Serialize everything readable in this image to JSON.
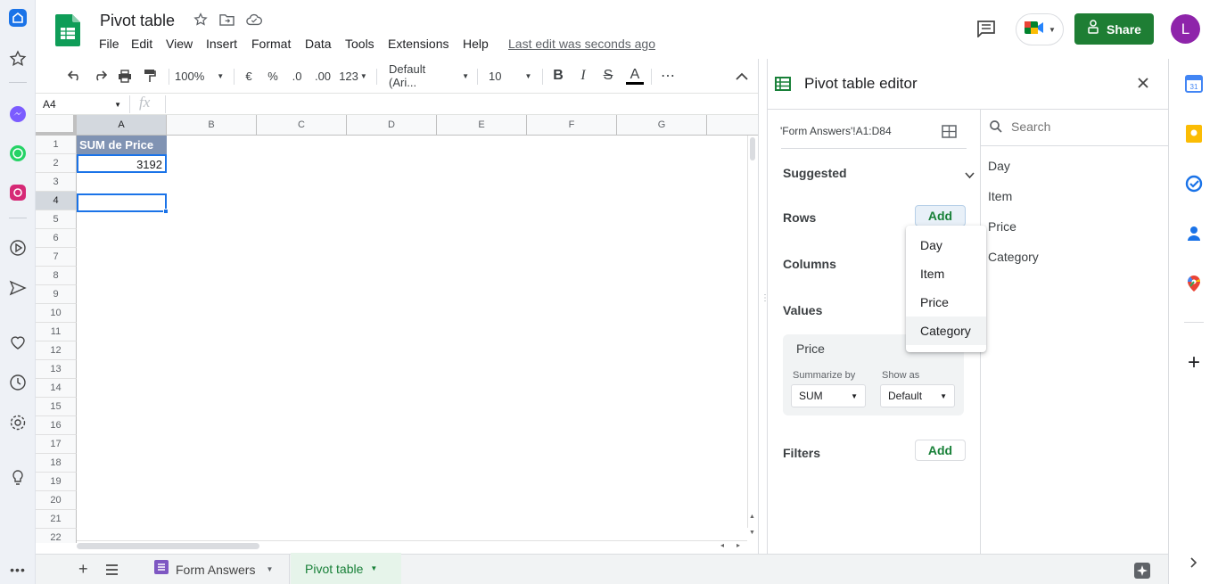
{
  "doc": {
    "title": "Pivot table",
    "last_edit": "Last edit was seconds ago",
    "share_label": "Share",
    "avatar_letter": "L"
  },
  "menu": [
    "File",
    "Edit",
    "View",
    "Insert",
    "Format",
    "Data",
    "Tools",
    "Extensions",
    "Help"
  ],
  "toolbar": {
    "zoom": "100%",
    "currency": "€",
    "percent": "%",
    "dec_decrease": ".0",
    "dec_increase": ".00",
    "format_more": "123",
    "font": "Default (Ari...",
    "font_size": "10",
    "bold": "B",
    "italic": "I",
    "strike": "S",
    "text_color": "A",
    "more": "⋯"
  },
  "formula_bar": {
    "cell_ref": "A4",
    "fx": "fx",
    "value": ""
  },
  "grid": {
    "columns": [
      "A",
      "B",
      "C",
      "D",
      "E",
      "F",
      "G"
    ],
    "rows": [
      "1",
      "2",
      "3",
      "4",
      "5",
      "6",
      "7",
      "8",
      "9",
      "10",
      "11",
      "12",
      "13",
      "14",
      "15",
      "16",
      "17",
      "18",
      "19",
      "20",
      "21",
      "22"
    ],
    "a1": "SUM de Price",
    "a2": "3192"
  },
  "sheets": [
    {
      "name": "Form Answers",
      "active": false
    },
    {
      "name": "Pivot table",
      "active": true
    }
  ],
  "editor": {
    "title": "Pivot table editor",
    "range": "'Form Answers'!A1:D84",
    "suggested": "Suggested",
    "rows_label": "Rows",
    "columns_label": "Columns",
    "values_label": "Values",
    "filters_label": "Filters",
    "add_label": "Add",
    "value_card": {
      "field": "Price",
      "summarize_label": "Summarize by",
      "summarize_value": "SUM",
      "show_as_label": "Show as",
      "show_as_value": "Default"
    },
    "search_placeholder": "Search",
    "fields": [
      "Day",
      "Item",
      "Price",
      "Category"
    ],
    "dropdown": [
      "Day",
      "Item",
      "Price",
      "Category"
    ]
  },
  "colors": {
    "accent_green": "#188038",
    "share_bg": "#1e7e34",
    "header_cell_bg": "#8093b3",
    "selection_blue": "#1a73e8",
    "avatar_bg": "#8e24aa"
  }
}
